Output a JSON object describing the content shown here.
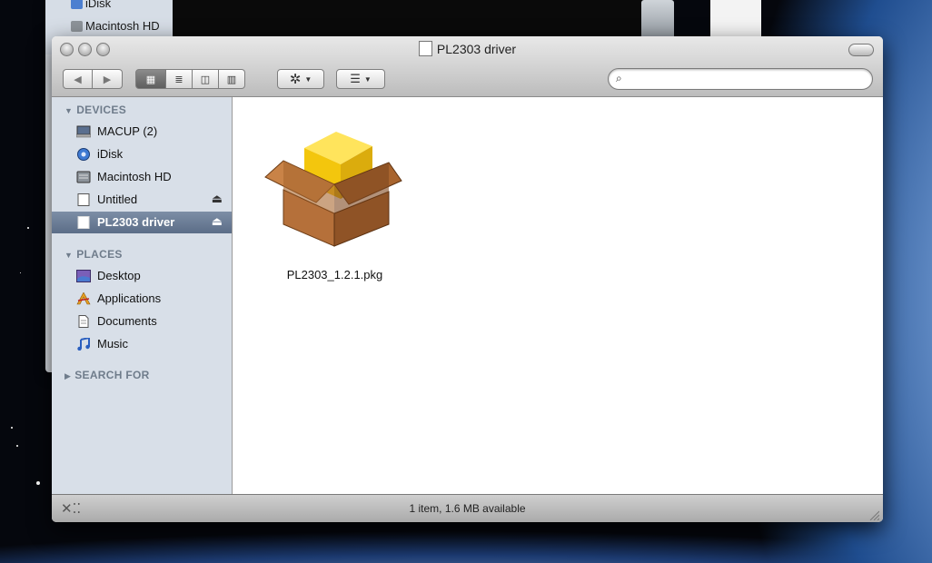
{
  "background_window": {
    "sidebar_items": [
      {
        "label": "iDisk",
        "icon": "idisk-icon"
      },
      {
        "label": "Macintosh HD",
        "icon": "hard-drive-icon"
      }
    ]
  },
  "window": {
    "title": "PL2303 driver"
  },
  "toolbar": {
    "view_buttons": [
      {
        "name": "icon-view",
        "glyph": "▦",
        "selected": true
      },
      {
        "name": "list-view",
        "glyph": "≣",
        "selected": false
      },
      {
        "name": "column-view",
        "glyph": "◫",
        "selected": false
      },
      {
        "name": "coverflow-view",
        "glyph": "▥",
        "selected": false
      }
    ],
    "search": {
      "value": "",
      "placeholder": ""
    }
  },
  "sidebar": {
    "sections": [
      {
        "title": "DEVICES",
        "items": [
          {
            "label": "MACUP (2)",
            "icon": "computer-icon",
            "eject": false,
            "selected": false
          },
          {
            "label": "iDisk",
            "icon": "idisk-icon",
            "eject": false,
            "selected": false
          },
          {
            "label": "Macintosh HD",
            "icon": "hard-drive-icon",
            "eject": false,
            "selected": false
          },
          {
            "label": "Untitled",
            "icon": "volume-icon",
            "eject": true,
            "selected": false
          },
          {
            "label": "PL2303 driver",
            "icon": "volume-icon",
            "eject": true,
            "selected": true
          }
        ]
      },
      {
        "title": "PLACES",
        "items": [
          {
            "label": "Desktop",
            "icon": "desktop-icon"
          },
          {
            "label": "Applications",
            "icon": "applications-icon"
          },
          {
            "label": "Documents",
            "icon": "documents-icon"
          },
          {
            "label": "Music",
            "icon": "music-icon"
          }
        ]
      },
      {
        "title": "SEARCH FOR",
        "collapsed": true,
        "items": []
      }
    ]
  },
  "content": {
    "files": [
      {
        "name": "PL2303_1.2.1.pkg",
        "icon": "package-icon"
      }
    ]
  },
  "statusbar": {
    "text": "1 item, 1.6 MB available"
  }
}
